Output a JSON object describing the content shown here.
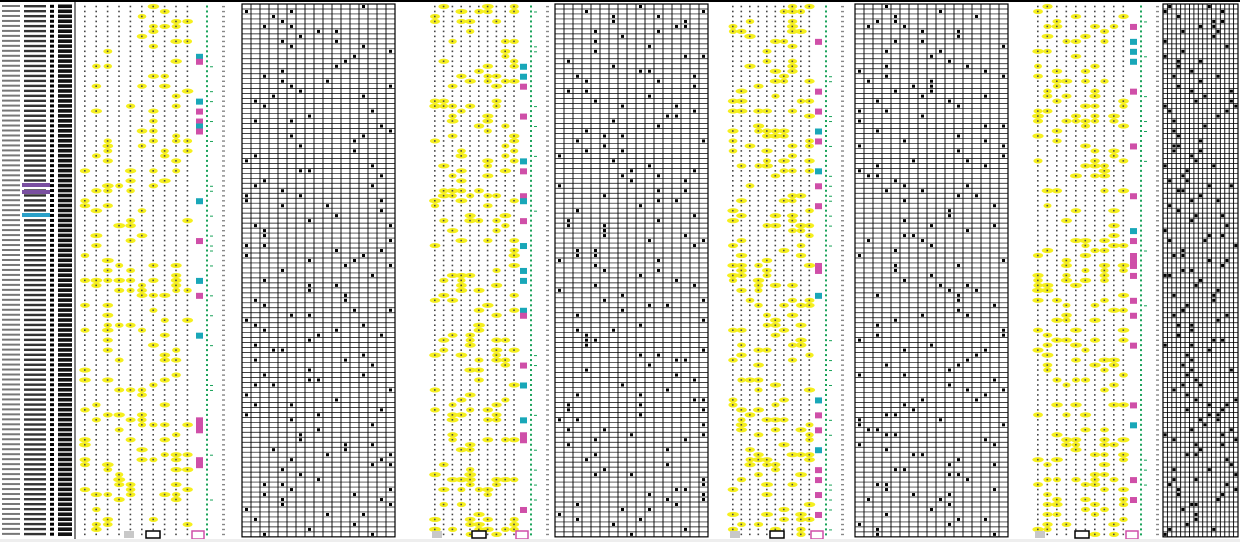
{
  "sheet": {
    "rows": 107,
    "panels": 4,
    "grid_columns": 17,
    "colors": {
      "highlight_yellow": "#f5ef1e",
      "marker_magenta": "#cf4fa8",
      "marker_cyan": "#19a7b8",
      "dash_green": "#1aa35a",
      "black": "#000000",
      "row_purple": "#7a4fa0",
      "row_teal": "#2aa0c8"
    },
    "icons": [
      "row-id-label",
      "date-cell",
      "number-cell",
      "grid-dot"
    ]
  }
}
